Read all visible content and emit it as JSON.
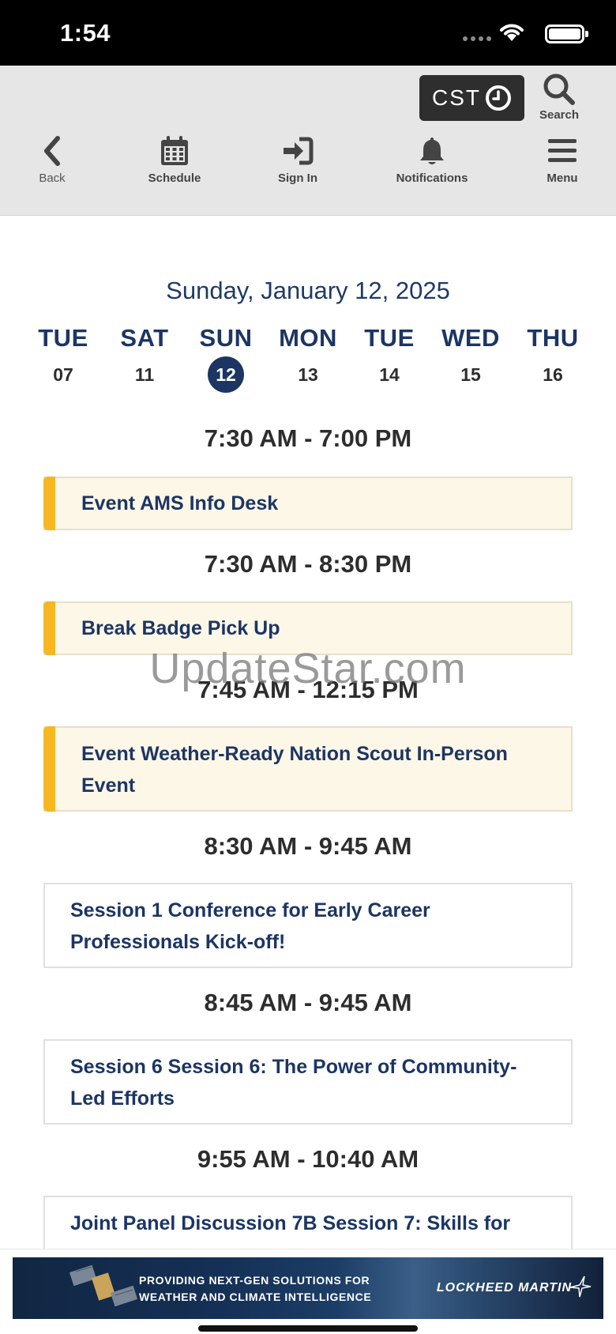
{
  "status_bar": {
    "time": "1:54"
  },
  "header": {
    "timezone_label": "CST",
    "search_label": "Search",
    "nav": [
      {
        "id": "back",
        "label": "Back"
      },
      {
        "id": "schedule",
        "label": "Schedule"
      },
      {
        "id": "sign-in",
        "label": "Sign In"
      },
      {
        "id": "notifications",
        "label": "Notifications"
      },
      {
        "id": "menu",
        "label": "Menu"
      }
    ]
  },
  "schedule": {
    "date_heading": "Sunday, January 12, 2025",
    "days": [
      {
        "name": "TUE",
        "num": "07"
      },
      {
        "name": "SAT",
        "num": "11"
      },
      {
        "name": "SUN",
        "num": "12",
        "active": true
      },
      {
        "name": "MON",
        "num": "13"
      },
      {
        "name": "TUE",
        "num": "14"
      },
      {
        "name": "WED",
        "num": "15"
      },
      {
        "name": "THU",
        "num": "16"
      }
    ],
    "blocks": [
      {
        "time": "7:30 AM - 7:00 PM",
        "event": "Event AMS Info Desk",
        "highlight": true
      },
      {
        "time": "7:30 AM - 8:30 PM",
        "event": "Break Badge Pick Up",
        "highlight": true
      },
      {
        "time": "7:45 AM - 12:15 PM",
        "event": "Event Weather-Ready Nation Scout In-Person Event",
        "highlight": true
      },
      {
        "time": "8:30 AM - 9:45 AM",
        "event": "Session 1 Conference for Early Career Professionals Kick-off!",
        "highlight": false
      },
      {
        "time": "8:45 AM - 9:45 AM",
        "event": "Session 6 Session 6: The Power of Community-Led Efforts",
        "highlight": false
      },
      {
        "time": "9:55 AM - 10:40 AM",
        "event": "Joint Panel Discussion 7B Session 7: Skills for",
        "highlight": false
      }
    ]
  },
  "watermark": "UpdateStar.com",
  "ad": {
    "line1": "PROVIDING NEXT-GEN SOLUTIONS FOR",
    "line2": "WEATHER AND CLIMATE INTELLIGENCE",
    "brand": "LOCKHEED MARTIN"
  },
  "colors": {
    "accent": "#1c3563",
    "highlight_bar": "#f7b720",
    "highlight_bg": "#fdf7e7"
  }
}
